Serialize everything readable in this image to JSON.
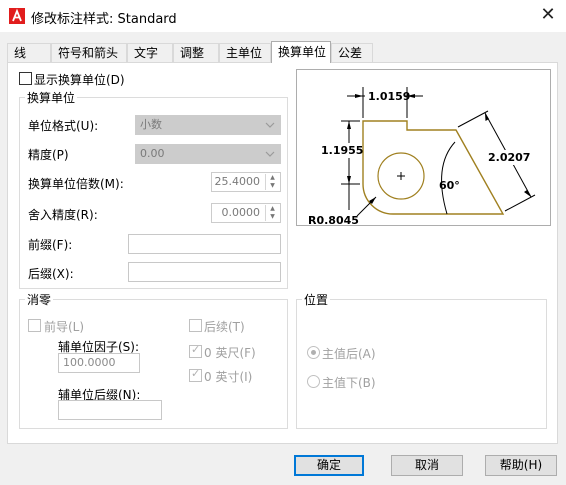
{
  "window": {
    "title": "修改标注样式: Standard",
    "close_glyph": "✕",
    "brand_color": "#e11d1d"
  },
  "tabs": [
    {
      "label": "线",
      "active": false
    },
    {
      "label": "符号和箭头",
      "active": false
    },
    {
      "label": "文字",
      "active": false
    },
    {
      "label": "调整",
      "active": false
    },
    {
      "label": "主单位",
      "active": false
    },
    {
      "label": "换算单位",
      "active": true
    },
    {
      "label": "公差",
      "active": false
    }
  ],
  "display_alt_units": {
    "label": "显示换算单位(D)",
    "checked": false
  },
  "alt_units": {
    "group_title": "换算单位",
    "unit_format": {
      "label": "单位格式(U):",
      "value": "小数"
    },
    "precision": {
      "label": "精度(P)",
      "value": "0.00"
    },
    "multiplier": {
      "label": "换算单位倍数(M):",
      "value": "25.4000"
    },
    "round_off": {
      "label": "舍入精度(R):",
      "value": "0.0000"
    },
    "prefix": {
      "label": "前缀(F):",
      "value": ""
    },
    "suffix": {
      "label": "后缀(X):",
      "value": ""
    }
  },
  "zero_suppression": {
    "group_title": "消零",
    "leading": {
      "label": "前导(L)",
      "checked": false
    },
    "sub_unit_factor": {
      "label": "辅单位因子(S):",
      "value": "100.0000"
    },
    "sub_unit_suffix": {
      "label": "辅单位后缀(N):",
      "value": ""
    },
    "trailing": {
      "label": "后续(T)",
      "checked": false
    },
    "feet": {
      "label": "0 英尺(F)",
      "checked": true
    },
    "inches": {
      "label": "0 英寸(I)",
      "checked": true
    }
  },
  "placement": {
    "group_title": "位置",
    "after_primary": {
      "label": "主值后(A)",
      "selected": true
    },
    "below_primary": {
      "label": "主值下(B)",
      "selected": false
    }
  },
  "preview": {
    "dim_top": "1.0159",
    "dim_left": "1.1955",
    "dim_right": "2.0207",
    "angle": "60°",
    "radius": "R0.8045",
    "shape_color": "#a08020"
  },
  "buttons": {
    "ok": "确定",
    "cancel": "取消",
    "help": "帮助(H)"
  }
}
